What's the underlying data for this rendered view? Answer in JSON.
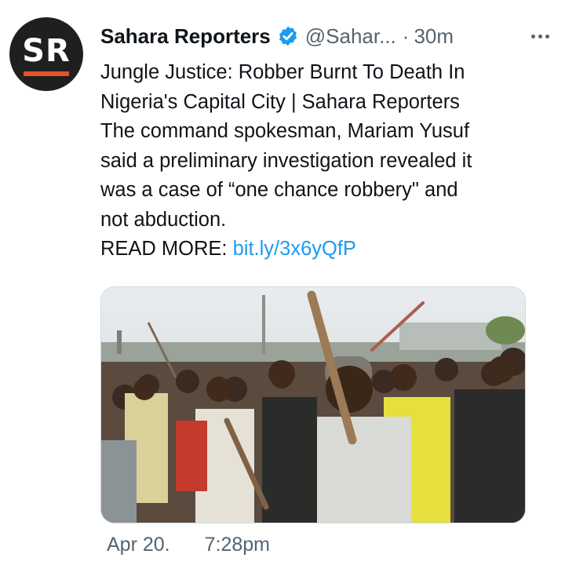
{
  "account": {
    "avatar_text": "SR",
    "name": "Sahara Reporters",
    "handle": "@Sahar...",
    "separator": "·",
    "time": "30m",
    "verified_color": "#1d9bf0"
  },
  "tweet": {
    "lines": [
      "Jungle Justice: Robber Burnt To Death In",
      "Nigeria's Capital City | Sahara Reporters",
      "The command spokesman, Mariam Yusuf",
      "said a preliminary investigation revealed it",
      "was a case of “one chance robbery\" and",
      "not abduction."
    ],
    "read_more_label": "READ MORE:",
    "link": "bit.ly/3x6yQfP"
  },
  "media": {
    "icon": "photo-crowd"
  },
  "footer": {
    "date": "Apr 20.",
    "time": "7:28pm"
  },
  "colors": {
    "link": "#1d9bf0",
    "secondary_text": "#536471",
    "avatar_bg": "#1f1f1f",
    "avatar_accent": "#e5532b"
  }
}
